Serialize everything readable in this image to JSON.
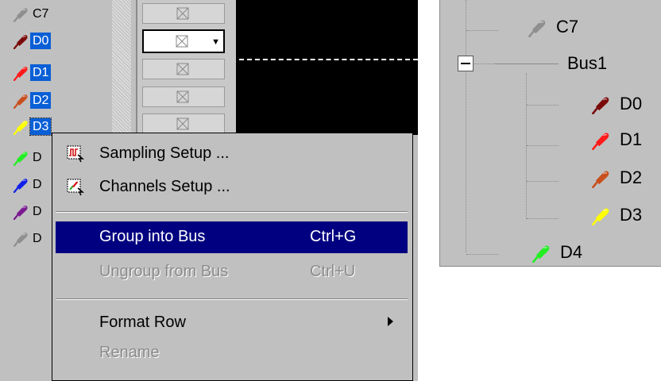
{
  "left_panel": {
    "channels": [
      {
        "label": "C7",
        "color": "#8f8f8f",
        "selected": false
      },
      {
        "label": "D0",
        "color": "#7a0a0a",
        "selected": true
      },
      {
        "label": "D1",
        "color": "#ff1a1a",
        "selected": true
      },
      {
        "label": "D2",
        "color": "#c8501e",
        "selected": true
      },
      {
        "label": "D3",
        "color": "#ffff00",
        "selected": true
      },
      {
        "label": "D",
        "color": "#22ee22",
        "selected": false
      },
      {
        "label": "D",
        "color": "#1020e8",
        "selected": false
      },
      {
        "label": "D",
        "color": "#7a1a90",
        "selected": false
      },
      {
        "label": "D",
        "color": "#8f8f8f",
        "selected": false
      }
    ]
  },
  "context_menu": {
    "items": [
      {
        "label": "Sampling Setup ...",
        "icon": "sampling-setup-icon",
        "shortcut": "",
        "state": "normal"
      },
      {
        "label": "Channels Setup ...",
        "icon": "channels-setup-icon",
        "shortcut": "",
        "state": "normal"
      },
      {
        "label": "Group into Bus",
        "shortcut": "Ctrl+G",
        "state": "highlighted"
      },
      {
        "label": "Ungroup from Bus",
        "shortcut": "Ctrl+U",
        "state": "disabled"
      },
      {
        "label": "Format Row",
        "shortcut": "",
        "state": "normal",
        "submenu": true
      },
      {
        "label": "Rename",
        "shortcut": "",
        "state": "disabled"
      }
    ]
  },
  "tree_panel": {
    "nodes": [
      {
        "label": "C7",
        "color": "#8f8f8f"
      },
      {
        "label": "Bus1",
        "expanded": true
      },
      {
        "label": "D0",
        "color": "#7a0a0a"
      },
      {
        "label": "D1",
        "color": "#ff1a1a"
      },
      {
        "label": "D2",
        "color": "#c8501e"
      },
      {
        "label": "D3",
        "color": "#ffff00"
      },
      {
        "label": "D4",
        "color": "#22ee22"
      }
    ]
  },
  "colors": {
    "selection": "#0a5fd6",
    "menu_highlight": "#000080",
    "panel_bg": "#c0c0c0"
  }
}
